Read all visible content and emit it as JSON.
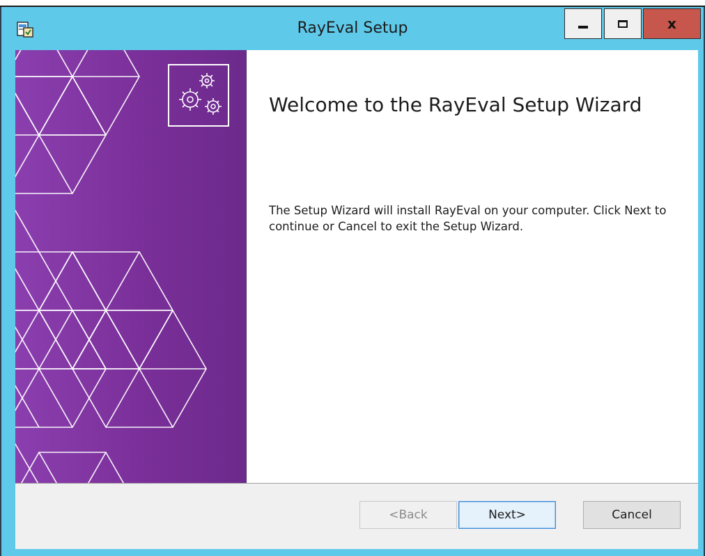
{
  "window": {
    "title": "RayEval Setup",
    "controls": {
      "minimize": "minimize",
      "maximize": "maximize",
      "close": "x"
    }
  },
  "main": {
    "heading": "Welcome to the RayEval Setup Wizard",
    "description": "The Setup Wizard will install RayEval on your computer. Click Next to continue or Cancel to exit the Setup Wizard."
  },
  "footer": {
    "back_label": "<Back",
    "back_enabled": false,
    "next_label": "Next>",
    "cancel_label": "Cancel"
  },
  "icons": {
    "app": "installer-icon",
    "banner": "gears-icon"
  },
  "colors": {
    "titlebar": "#5fc9ea",
    "banner": "#7a2f99",
    "close_button": "#c7564c",
    "default_button_border": "#3c8bd9"
  }
}
